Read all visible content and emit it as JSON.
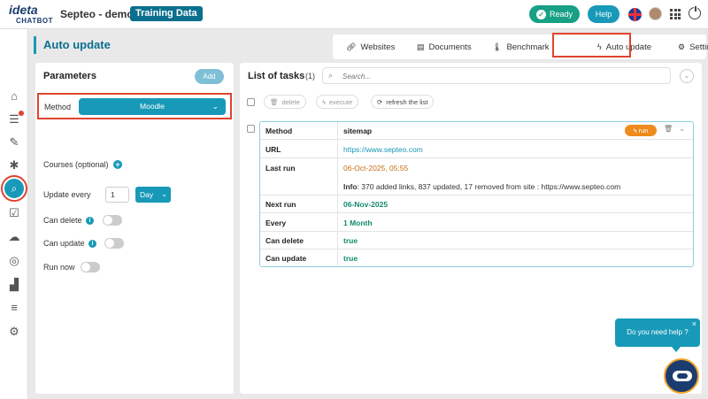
{
  "app": {
    "logo_top": "ideta",
    "logo_bottom": "CHATBOT",
    "project_name": "Septeo - demo",
    "dataset_badge": "Training Data",
    "status": "Ready",
    "help": "Help"
  },
  "sidebar": {
    "icons": [
      "home-icon",
      "list-icon",
      "edit-icon",
      "bug-icon",
      "knowledge-search-icon",
      "checklist-icon",
      "cloud-settings-icon",
      "chat-search-icon",
      "analytics-icon",
      "database-icon",
      "settings-icon"
    ],
    "active": "knowledge-search-icon"
  },
  "page": {
    "title": "Auto update"
  },
  "tabs": [
    {
      "label": "Websites",
      "icon": "link-icon"
    },
    {
      "label": "Documents",
      "icon": "document-icon"
    },
    {
      "label": "Benchmark",
      "icon": "thermometer-icon"
    },
    {
      "label": "Auto update",
      "icon": "bolt-icon",
      "active": true
    },
    {
      "label": "Settings",
      "icon": "gears-icon"
    }
  ],
  "parameters": {
    "title": "Parameters",
    "add_label": "Add",
    "method_label": "Method",
    "method_value": "Moodle",
    "courses_label": "Courses (optional)",
    "update_every_label": "Update every",
    "update_every_value": "1",
    "update_every_unit": "Day",
    "can_delete_label": "Can delete",
    "can_update_label": "Can update",
    "run_now_label": "Run now"
  },
  "tasks": {
    "title": "List of tasks",
    "count": "(1)",
    "search_placeholder": "Search...",
    "actions": {
      "delete": "delete",
      "execute": "execute",
      "refresh": "refresh the list"
    },
    "task": {
      "run_label": "run",
      "rows": [
        {
          "key": "Method",
          "value": "sitemap"
        },
        {
          "key": "URL",
          "value": "https://www.septeo.com"
        },
        {
          "key": "Last run",
          "value": "06-Oct-2025, 05:55"
        },
        {
          "key": "",
          "info_label": "Info",
          "value": ": 370 added links, 837 updated, 17 removed from site : https://www.septeo.com"
        },
        {
          "key": "Next run",
          "value": "06-Nov-2025"
        },
        {
          "key": "Every",
          "value": "1 Month"
        },
        {
          "key": "Can delete",
          "value": "true"
        },
        {
          "key": "Can update",
          "value": "true"
        }
      ]
    }
  },
  "help_widget": {
    "bubble": "Do you need help ?",
    "close": "×"
  },
  "colors": {
    "primary": "#1899b8",
    "dark_teal": "#0b6f8e",
    "success": "#17a085",
    "warning": "#ef8a1c",
    "highlight": "#e0432f"
  }
}
